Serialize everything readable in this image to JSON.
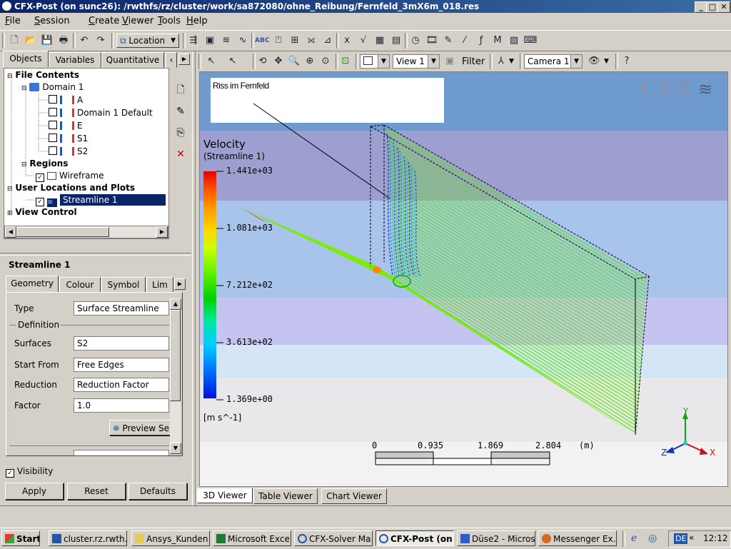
{
  "window": {
    "title": "CFX-Post (on sunc26): /rwthfs/rz/cluster/work/sa872080/ohne_Reibung/Fernfeld_3mX6m_018.res",
    "controls": [
      "_",
      "□",
      "✕"
    ]
  },
  "menubar": [
    {
      "label": "File",
      "key": "F"
    },
    {
      "label": "Session",
      "key": "S"
    },
    {
      "label": "Create",
      "key": "C"
    },
    {
      "label": "Viewer",
      "key": "V"
    },
    {
      "label": "Tools",
      "key": "T"
    },
    {
      "label": "Help",
      "key": "H"
    }
  ],
  "toolbar": {
    "location_label": "Location"
  },
  "left_tabs": [
    "Objects",
    "Variables",
    "Quantitative"
  ],
  "tree": {
    "file_contents": "File Contents",
    "domain": "Domain 1",
    "children": [
      "A",
      "Domain 1 Default",
      "E",
      "S1",
      "S2"
    ],
    "regions": "Regions",
    "wireframe": "Wireframe",
    "user_locations": "User Locations and Plots",
    "streamline": "Streamline 1",
    "view_control": "View Control"
  },
  "details": {
    "title": "Streamline 1",
    "tabs": [
      "Geometry",
      "Colour",
      "Symbol",
      "Lim"
    ],
    "type_label": "Type",
    "type_value": "Surface Streamline",
    "definition_label": "Definition",
    "surfaces_label": "Surfaces",
    "surfaces_value": "S2",
    "start_from_label": "Start From",
    "start_from_value": "Free Edges",
    "reduction_label": "Reduction",
    "reduction_value": "Reduction Factor",
    "factor_label": "Factor",
    "factor_value": "1.0",
    "preview_label": "Preview Se",
    "visibility_label": "Visibility",
    "apply_label": "Apply",
    "reset_label": "Reset",
    "defaults_label": "Defaults"
  },
  "viewer": {
    "view_select": "View 1",
    "filter_label": "Filter",
    "camera_select": "Camera 1",
    "annotation_text": "Riss im Fernfeld",
    "logo_text": "CFX",
    "legend_title": "Velocity",
    "legend_subtitle": "(Streamline 1)",
    "legend_values": [
      "1.441e+03",
      "1.081e+03",
      "7.212e+02",
      "3.613e+02",
      "1.369e+00"
    ],
    "legend_unit": "[m s^-1]",
    "scale_values": [
      "0",
      "0.935",
      "1.869",
      "2.804"
    ],
    "scale_unit": "(m)",
    "axis_labels": [
      "Y",
      "Z",
      "X"
    ],
    "tabs": [
      "3D Viewer",
      "Table Viewer",
      "Chart Viewer"
    ]
  },
  "taskbar": {
    "start_label": "Start",
    "items": [
      "cluster.rz.rwth...",
      "Ansys_Kunden...",
      "Microsoft Excel...",
      "CFX-Solver Ma...",
      "CFX-Post (on ...",
      "Düse2 - Micros...",
      "Messenger Ex..."
    ],
    "lang": "DE",
    "clock": "12:12"
  },
  "colors": {
    "accent": "#0a246a",
    "streamline_green": "#66e61a",
    "viewport_top": "#6f9acf"
  }
}
